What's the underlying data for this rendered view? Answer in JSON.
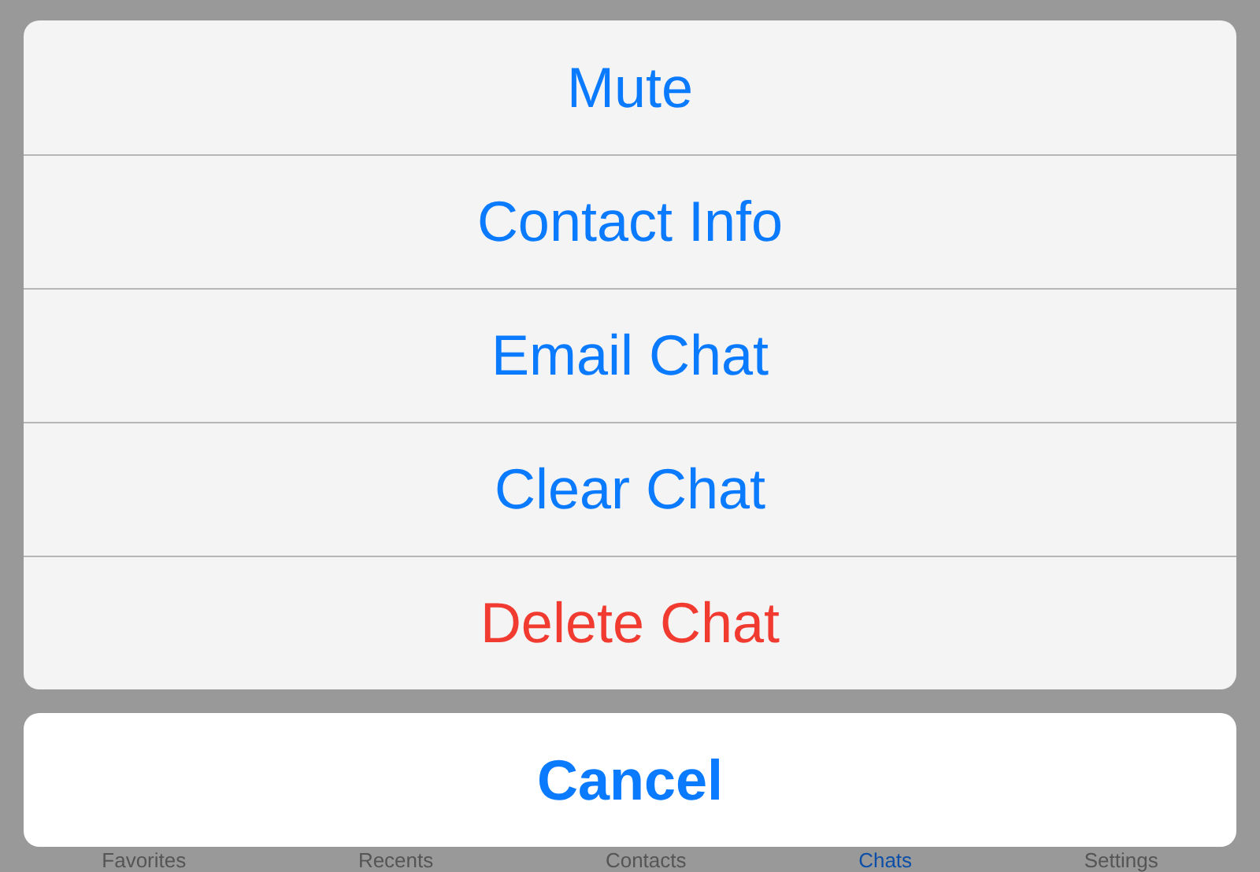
{
  "action_sheet": {
    "items": [
      {
        "label": "Mute",
        "kind": "default"
      },
      {
        "label": "Contact Info",
        "kind": "default"
      },
      {
        "label": "Email Chat",
        "kind": "default"
      },
      {
        "label": "Clear Chat",
        "kind": "default"
      },
      {
        "label": "Delete Chat",
        "kind": "destructive"
      }
    ],
    "cancel": "Cancel"
  },
  "tab_bar": [
    {
      "label": "Favorites",
      "selected": false
    },
    {
      "label": "Recents",
      "selected": false
    },
    {
      "label": "Contacts",
      "selected": false
    },
    {
      "label": "Chats",
      "selected": true
    },
    {
      "label": "Settings",
      "selected": false
    }
  ]
}
